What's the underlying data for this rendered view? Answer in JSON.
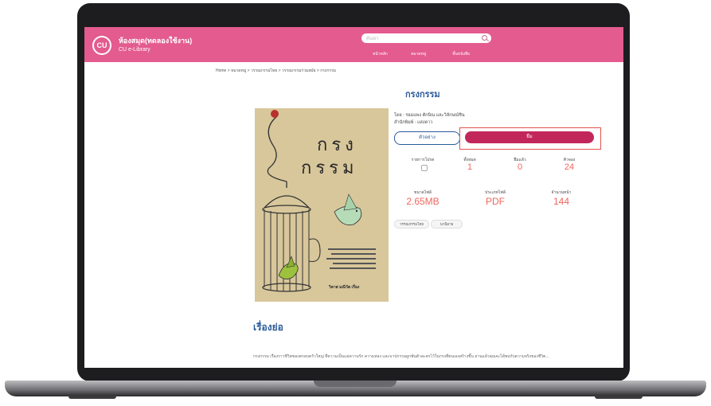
{
  "header": {
    "logo_text": "CU",
    "site_title": "ห้องสมุด(ทดลองใช้งาน)",
    "site_subtitle": "CU e-Library",
    "search_placeholder": "ค้นหา",
    "nav": [
      "หน้าหลัก",
      "หมวดหมู่",
      "ชั้นหนังสือ"
    ]
  },
  "breadcrumb": "Home > หมวดหมู่ > วรรณกรรมไทย > วรรณกรรมร่วมสมัย > กรงกรรม",
  "book": {
    "title": "กรงกรรม",
    "author": "โดย : รอมแพง ตักษิณ และวิลักษณ์ชิน",
    "publisher": "สำนักพิมพ์ : แสงดาว",
    "cover_title_line1": "กรง",
    "cover_title_line2": "กรรม",
    "cover_author": "วิลาส มณีวัต เรื่อง"
  },
  "actions": {
    "sample_label": "ตัวอย่าง",
    "borrow_label": "ยืม"
  },
  "stats_row1": [
    {
      "label": "รายการโปรด",
      "value": ""
    },
    {
      "label": "ทั้งหมด",
      "value": "1"
    },
    {
      "label": "ยืมแล้ว",
      "value": "0"
    },
    {
      "label": "คิวจอง",
      "value": "24"
    }
  ],
  "stats_row2": [
    {
      "label": "ขนาดไฟล์",
      "value": "2.65MB"
    },
    {
      "label": "ประเภทไฟล์",
      "value": "PDF"
    },
    {
      "label": "จำนวนหน้า",
      "value": "144"
    }
  ],
  "tags": [
    "วรรณกรรมไทย",
    "นวนิยาย"
  ],
  "synopsis": {
    "title": "เรื่องย่อ",
    "body": "กรงกรรม เรื่องราวชีวิตของครอบครัวใหญ่ ที่ความเป็นแม่ความรัก ความหลง และบาปกรรมผูกพันตัวละครไว้ในกรงที่ตนเองสร้างขึ้น อ่านแล้วคุณจะได้พบกับความจริงของชีวิต..."
  },
  "colors": {
    "header": "#e35b8f",
    "primary_button": "#c2275b",
    "accent_text": "#2a5b9a",
    "stat_value": "#f0665d"
  }
}
